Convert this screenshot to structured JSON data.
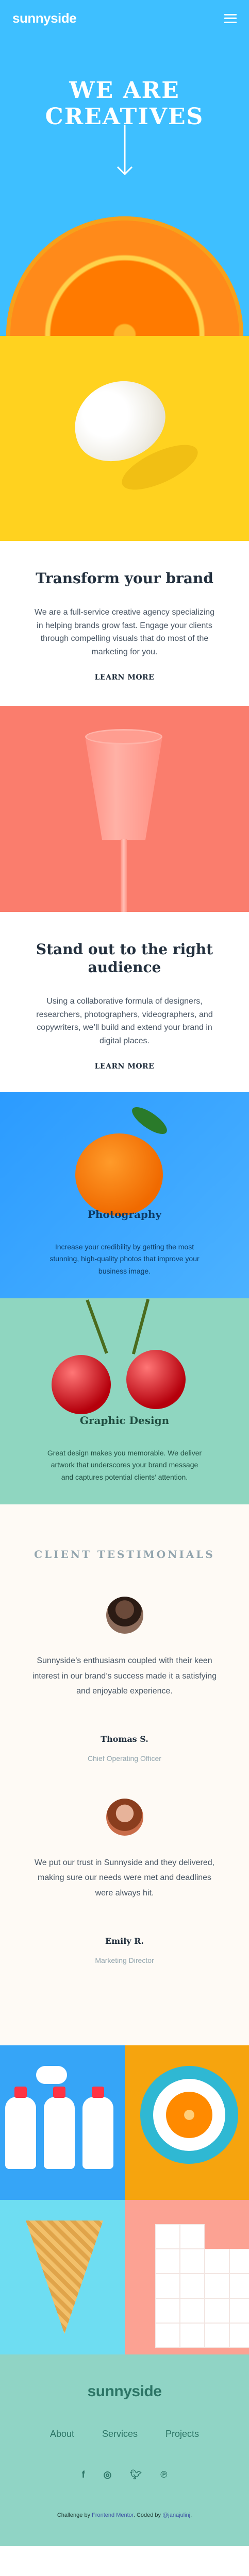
{
  "header": {
    "logo": "sunnyside",
    "menu_icon": "hamburger-icon"
  },
  "hero": {
    "title": "WE ARE CREATIVES",
    "arrow_icon": "arrow-down-icon"
  },
  "transform": {
    "title": "Transform your brand",
    "body": "We are a full-service creative agency specializing in helping brands grow fast. Engage your clients through compelling visuals that do most of the marketing for you.",
    "link": "LEARN MORE",
    "accent": "#ffd21f"
  },
  "standout": {
    "title": "Stand out to the right audience",
    "body": "Using a collaborative formula of designers, researchers, photographers, videographers, and copywriters, we’ll build and extend your brand in digital places.",
    "link": "LEARN MORE",
    "accent": "#ff8c75"
  },
  "services": [
    {
      "title": "Photography",
      "body": "Increase your credibility by getting the most stunning, high-quality photos that improve your business image."
    },
    {
      "title": "Graphic Design",
      "body": "Great design makes you memorable. We deliver artwork that underscores your brand message and captures potential clients’ attention."
    }
  ],
  "testimonials": {
    "heading": "CLIENT TESTIMONIALS",
    "items": [
      {
        "quote": "Sunnyside’s enthusiasm coupled with their keen interest in our brand’s success made it a satisfying and enjoyable experience.",
        "name": "Thomas S.",
        "role": "Chief Operating Officer"
      },
      {
        "quote": "We put our trust in Sunnyside and they delivered, making sure our needs were met and deadlines were always hit.",
        "name": "Emily R.",
        "role": "Marketing Director"
      }
    ]
  },
  "footer": {
    "logo": "sunnyside",
    "links": [
      "About",
      "Services",
      "Projects"
    ],
    "social_icons": [
      "facebook-icon",
      "instagram-icon",
      "twitter-icon",
      "pinterest-icon"
    ],
    "attribution_prefix": "Challenge by",
    "attribution_link1": "Frontend Mentor",
    "attribution_mid": ". Coded by",
    "attribution_link2": "@janajulinj",
    "attribution_suffix": "."
  }
}
